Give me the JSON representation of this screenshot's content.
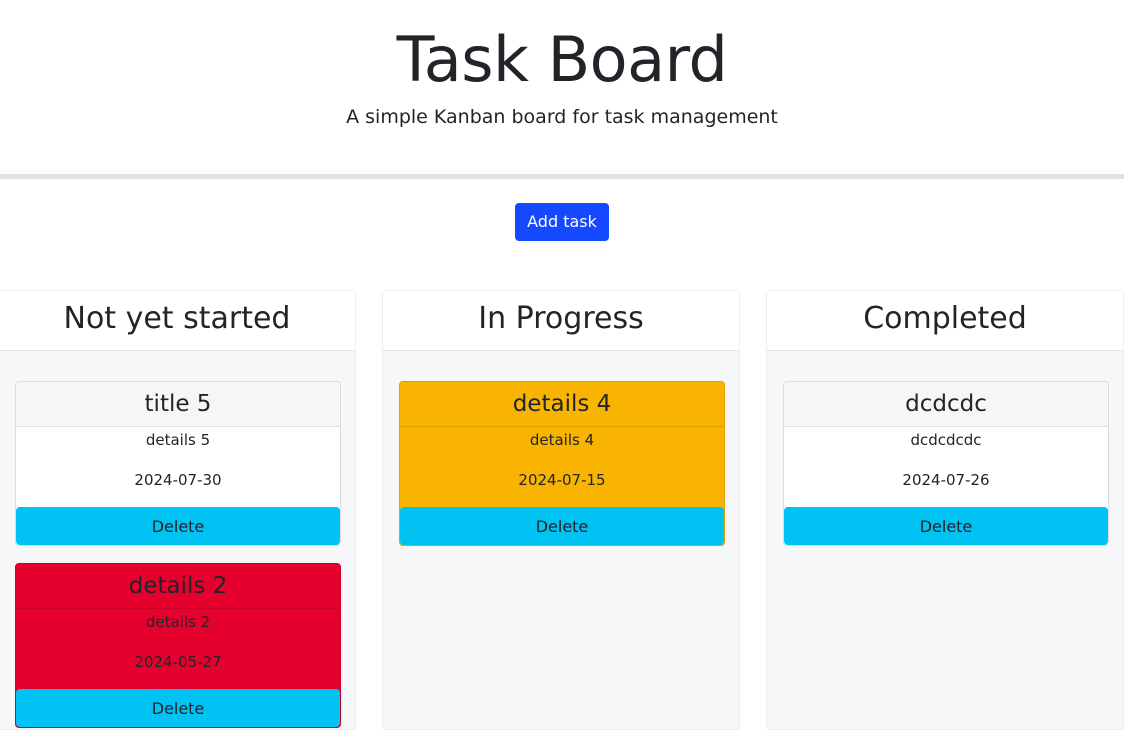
{
  "header": {
    "title": "Task Board",
    "subtitle": "A simple Kanban board for task management"
  },
  "toolbar": {
    "add_label": "Add task"
  },
  "lanes": [
    {
      "title": "Not yet started",
      "cards": [
        {
          "title": "title 5",
          "details": "details 5",
          "date": "2024-07-30",
          "delete_label": "Delete",
          "color": "#ffffff"
        },
        {
          "title": "details 2",
          "details": "details 2",
          "date": "2024-05-27",
          "delete_label": "Delete",
          "color": "#e5002e"
        }
      ]
    },
    {
      "title": "In Progress",
      "cards": [
        {
          "title": "details 4",
          "details": "details 4",
          "date": "2024-07-15",
          "delete_label": "Delete",
          "color": "#f8b400"
        }
      ]
    },
    {
      "title": "Completed",
      "cards": [
        {
          "title": "dcdcdc",
          "details": "dcdcdcdc",
          "date": "2024-07-26",
          "delete_label": "Delete",
          "color": "#ffffff"
        }
      ]
    }
  ],
  "colors": {
    "accent": "#1649ff",
    "delete": "#00c3f3"
  }
}
